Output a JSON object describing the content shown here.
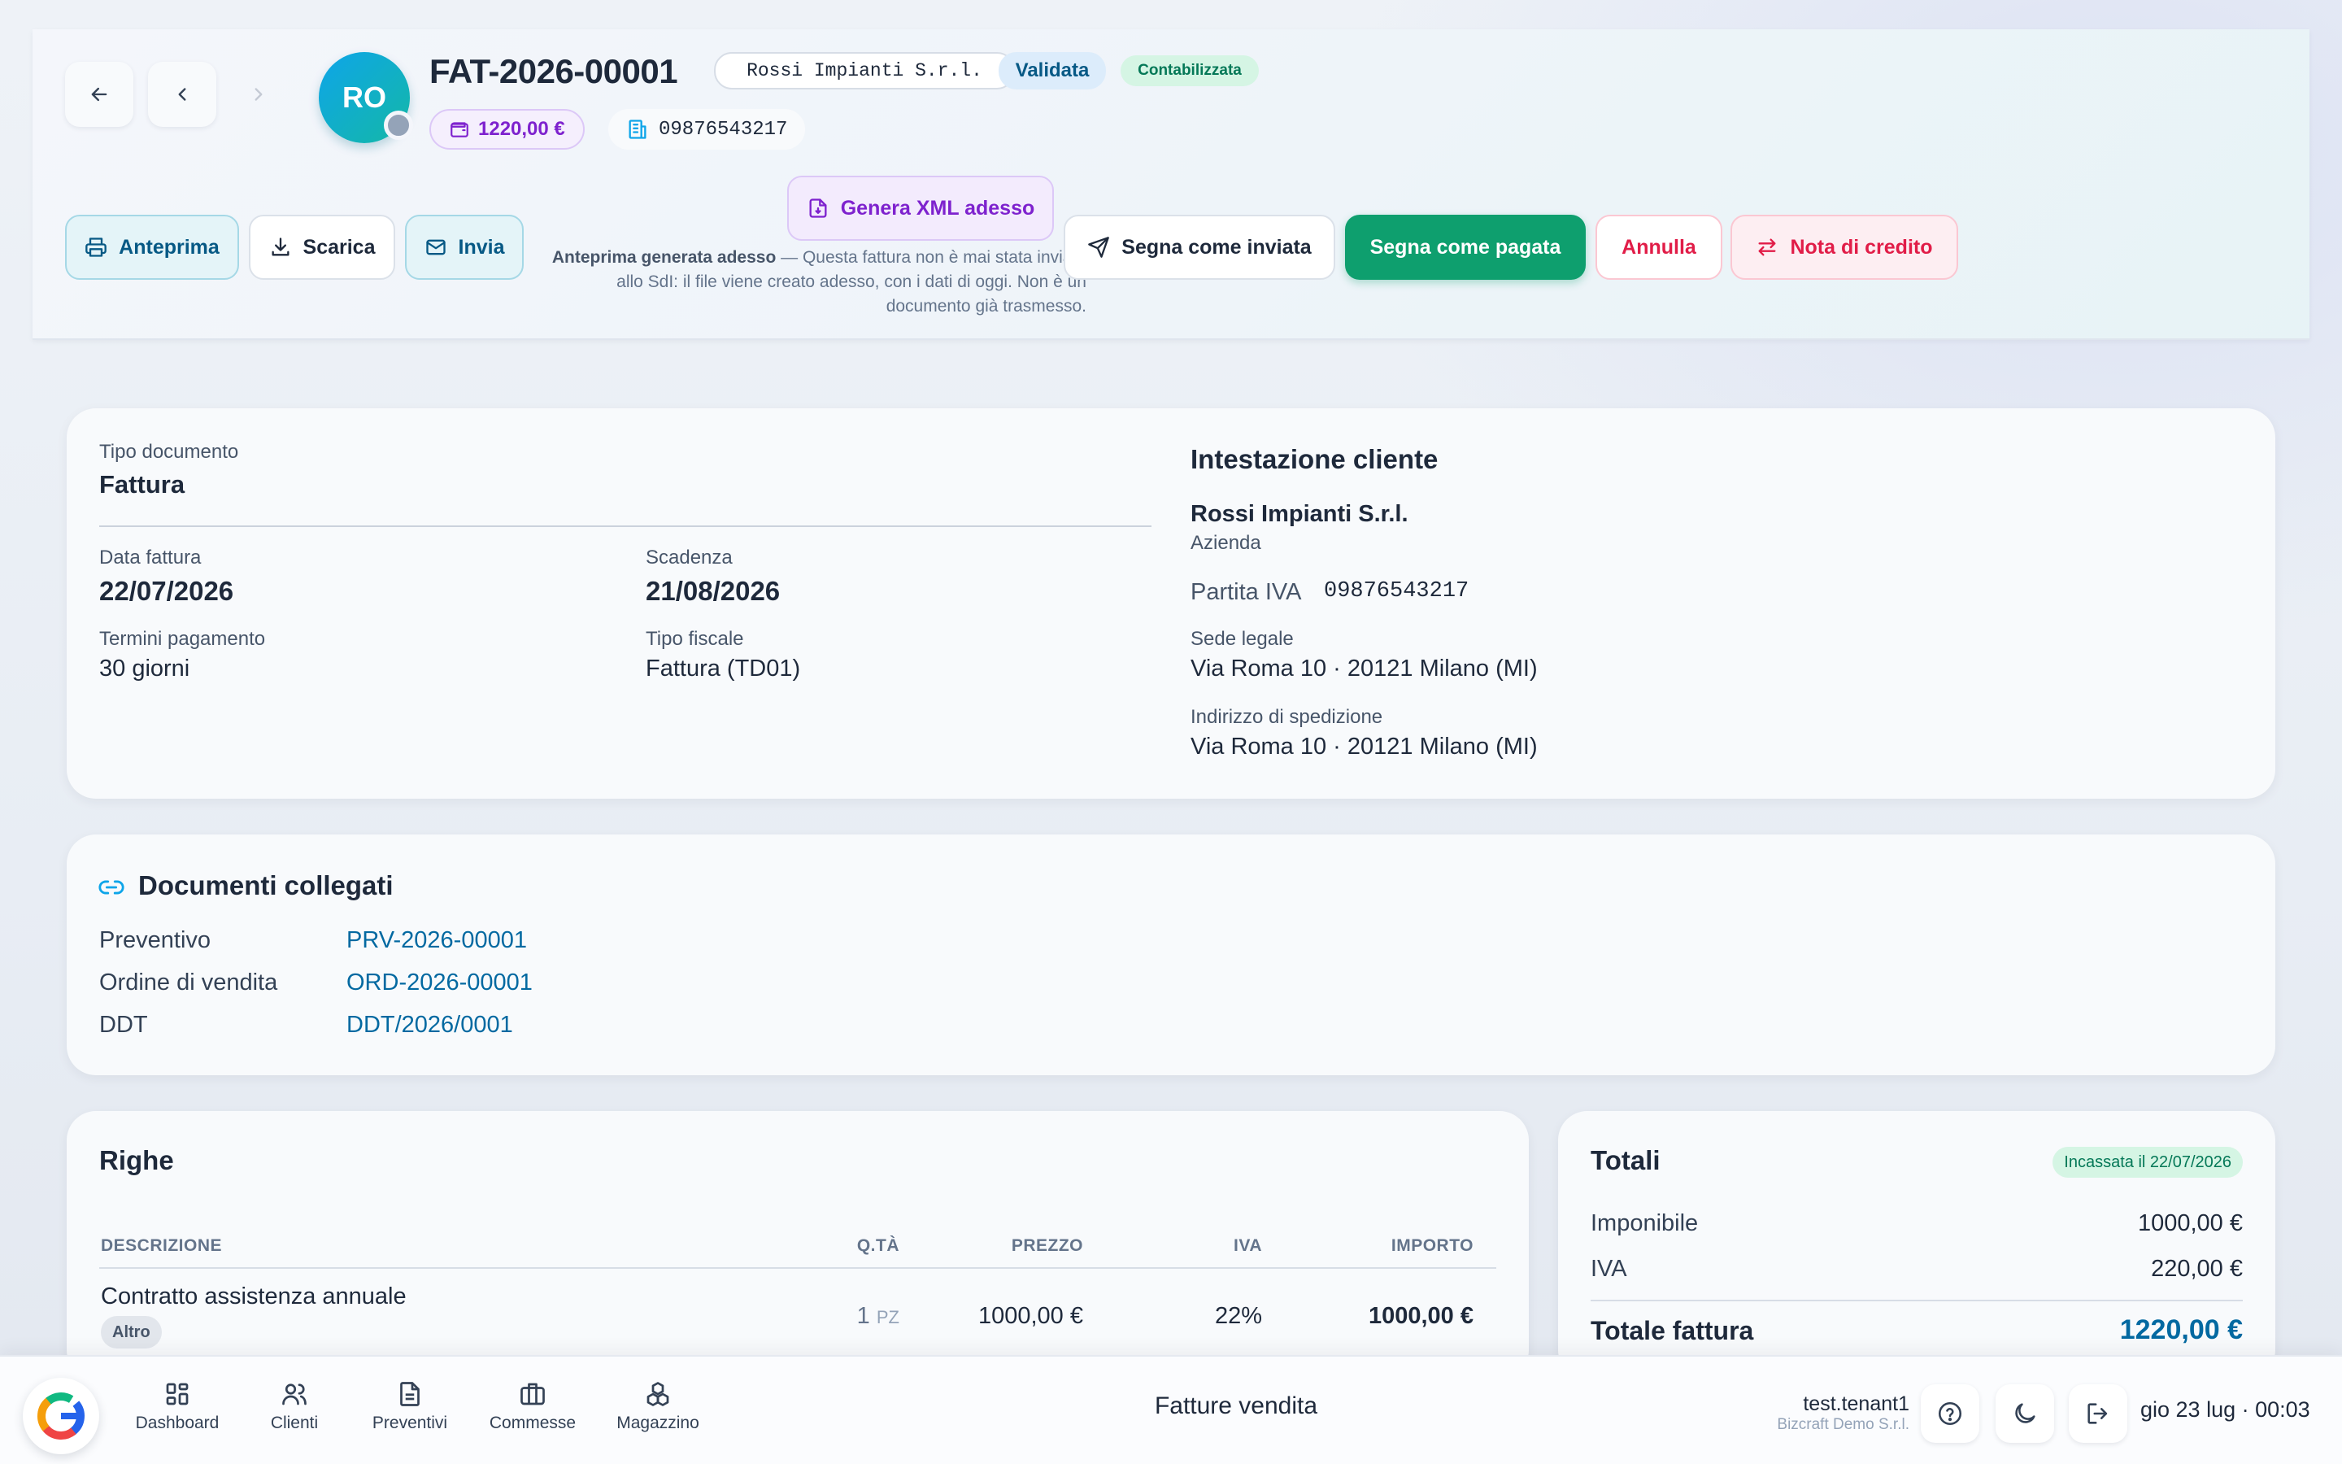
{
  "header": {
    "invoice_number": "FAT-2026-00001",
    "customer_tag": "Rossi Impianti S.r.l.",
    "status_validated": "Validata",
    "status_booked": "Contabilizzata",
    "avatar_initials": "RO",
    "amount": "1220,00 €",
    "vat_number": "09876543217",
    "actions": {
      "preview": "Anteprima",
      "download": "Scarica",
      "send": "Invia",
      "generate_xml": "Genera XML adesso",
      "mark_sent": "Segna come inviata",
      "mark_paid": "Segna come pagata",
      "cancel": "Annulla",
      "credit_note": "Nota di credito"
    },
    "hint_bold": "Anteprima generata adesso",
    "hint_text": " — Questa fattura non è mai stata inviata allo SdI: il file viene creato adesso, con i dati di oggi. Non è un documento già trasmesso."
  },
  "details": {
    "doc_type_label": "Tipo documento",
    "doc_type_value": "Fattura",
    "invoice_date_label": "Data fattura",
    "invoice_date_value": "22/07/2026",
    "due_label": "Scadenza",
    "due_value": "21/08/2026",
    "terms_label": "Termini pagamento",
    "terms_value": "30 giorni",
    "fiscal_label": "Tipo fiscale",
    "fiscal_value": "Fattura (TD01)"
  },
  "customer": {
    "section_title": "Intestazione cliente",
    "name": "Rossi Impianti S.r.l.",
    "kind": "Azienda",
    "vat_label": "Partita IVA",
    "vat_value": "09876543217",
    "legal_label": "Sede legale",
    "legal_value": "Via Roma 10 · 20121 Milano (MI)",
    "shipping_label": "Indirizzo di spedizione",
    "shipping_value": "Via Roma 10 · 20121 Milano (MI)"
  },
  "linked": {
    "title": "Documenti collegati",
    "rows": [
      {
        "label": "Preventivo",
        "value": "PRV-2026-00001"
      },
      {
        "label": "Ordine di vendita",
        "value": "ORD-2026-00001"
      },
      {
        "label": "DDT",
        "value": "DDT/2026/0001"
      }
    ]
  },
  "lines": {
    "title": "Righe",
    "columns": [
      "DESCRIZIONE",
      "Q.TÀ",
      "PREZZO",
      "IVA",
      "IMPORTO"
    ],
    "rows": [
      {
        "description": "Contratto assistenza annuale",
        "tag": "Altro",
        "qty": "1",
        "unit": "PZ",
        "price": "1000,00 €",
        "vat": "22%",
        "amount": "1000,00 €"
      }
    ]
  },
  "totals": {
    "title": "Totali",
    "paid_badge": "Incassata il 22/07/2026",
    "taxable_label": "Imponibile",
    "taxable_value": "1000,00 €",
    "vat_label": "IVA",
    "vat_value": "220,00 €",
    "total_label": "Totale fattura",
    "total_value": "1220,00 €"
  },
  "bottombar": {
    "nav": [
      {
        "label": "Dashboard",
        "icon": "dashboard-icon"
      },
      {
        "label": "Clienti",
        "icon": "users-icon"
      },
      {
        "label": "Preventivi",
        "icon": "document-icon"
      },
      {
        "label": "Commesse",
        "icon": "briefcase-icon"
      },
      {
        "label": "Magazzino",
        "icon": "boxes-icon"
      }
    ],
    "page_title": "Fatture vendita",
    "user": "test.tenant1",
    "company": "Bizcraft Demo S.r.l.",
    "datetime": "gio 23 lug · 00:03"
  },
  "colors": {
    "primary_green": "#0e9f6e",
    "link_blue": "#0369a1",
    "danger": "#e11d48",
    "xml_purple": "#7e22ce"
  }
}
